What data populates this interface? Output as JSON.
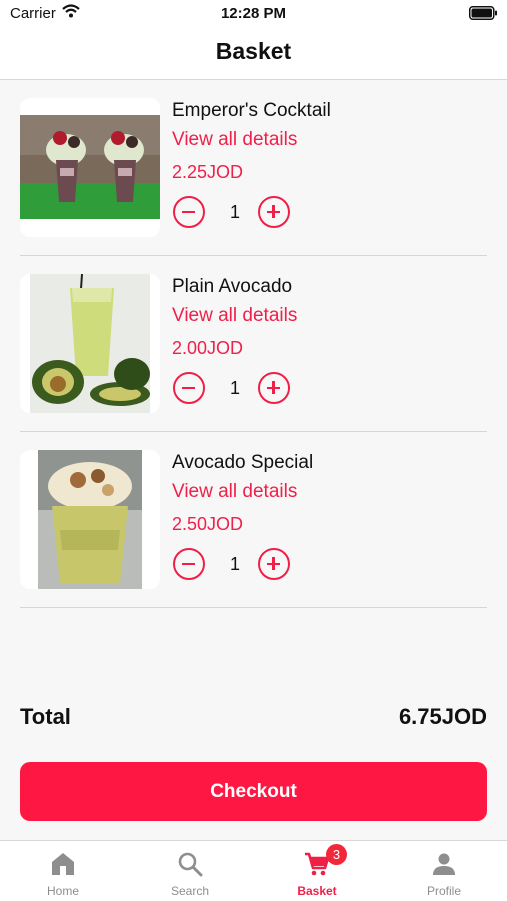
{
  "status_bar": {
    "carrier": "Carrier",
    "time": "12:28 PM"
  },
  "nav": {
    "title": "Basket"
  },
  "items": [
    {
      "name": "Emperor's Cocktail",
      "details_label": "View all details",
      "price": "2.25JOD",
      "quantity": "1"
    },
    {
      "name": "Plain Avocado",
      "details_label": "View all details",
      "price": "2.00JOD",
      "quantity": "1"
    },
    {
      "name": "Avocado Special",
      "details_label": "View all details",
      "price": "2.50JOD",
      "quantity": "1"
    }
  ],
  "summary": {
    "total_label": "Total",
    "total_value": "6.75JOD"
  },
  "checkout_label": "Checkout",
  "tabs": [
    {
      "label": "Home",
      "icon": "home-icon"
    },
    {
      "label": "Search",
      "icon": "search-icon"
    },
    {
      "label": "Basket",
      "icon": "cart-icon",
      "badge": "3",
      "active": true
    },
    {
      "label": "Profile",
      "icon": "person-icon"
    }
  ],
  "colors": {
    "accent": "#ff1744",
    "tab_inactive": "#8e8e8e",
    "badge": "#f0283a"
  }
}
